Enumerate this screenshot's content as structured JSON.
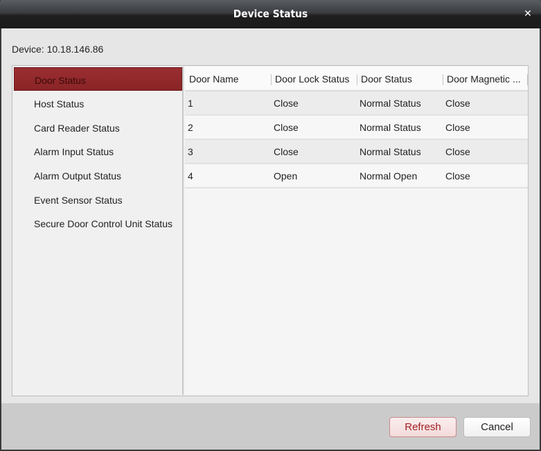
{
  "window": {
    "title": "Device Status",
    "close_icon": "close-icon"
  },
  "device": {
    "label": "Device: 10.18.146.86"
  },
  "sidebar": {
    "items": [
      {
        "label": "Door Status",
        "active": true
      },
      {
        "label": "Host Status",
        "active": false
      },
      {
        "label": "Card Reader Status",
        "active": false
      },
      {
        "label": "Alarm Input Status",
        "active": false
      },
      {
        "label": "Alarm Output Status",
        "active": false
      },
      {
        "label": "Event Sensor Status",
        "active": false
      },
      {
        "label": "Secure Door Control Unit Status",
        "active": false
      }
    ]
  },
  "table": {
    "columns": [
      "Door Name",
      "Door Lock Status",
      "Door Status",
      "Door Magnetic ..."
    ],
    "rows": [
      [
        "1",
        "Close",
        "Normal Status",
        "Close"
      ],
      [
        "2",
        "Close",
        "Normal Status",
        "Close"
      ],
      [
        "3",
        "Close",
        "Normal Status",
        "Close"
      ],
      [
        "4",
        "Open",
        "Normal Open",
        "Close"
      ]
    ]
  },
  "footer": {
    "refresh_label": "Refresh",
    "cancel_label": "Cancel"
  },
  "colors": {
    "active_item": "#8f282a",
    "refresh_text": "#a21e24",
    "titlebar": "#1e1e1e"
  }
}
